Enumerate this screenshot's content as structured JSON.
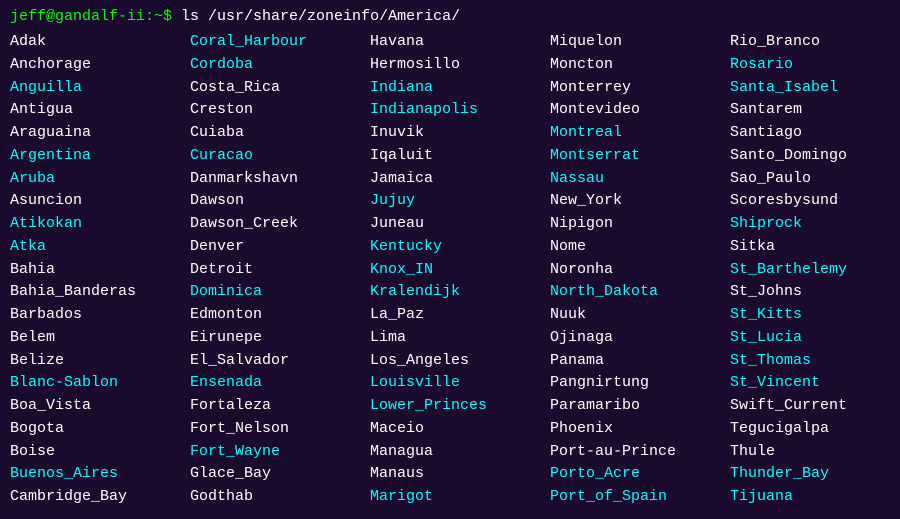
{
  "prompt": {
    "user": "jeff@gandalf-ii:~$",
    "command": " ls /usr/share/zoneinfo/America/"
  },
  "columns": [
    [
      {
        "text": "Adak",
        "color": "white"
      },
      {
        "text": "Anchorage",
        "color": "white"
      },
      {
        "text": "Anguilla",
        "color": "cyan"
      },
      {
        "text": "Antigua",
        "color": "white"
      },
      {
        "text": "Araguaina",
        "color": "white"
      },
      {
        "text": "Argentina",
        "color": "cyan"
      },
      {
        "text": "Aruba",
        "color": "cyan"
      },
      {
        "text": "Asuncion",
        "color": "white"
      },
      {
        "text": "Atikokan",
        "color": "cyan"
      },
      {
        "text": "Atka",
        "color": "cyan"
      },
      {
        "text": "Bahia",
        "color": "white"
      },
      {
        "text": "Bahia_Banderas",
        "color": "white"
      },
      {
        "text": "Barbados",
        "color": "white"
      },
      {
        "text": "Belem",
        "color": "white"
      },
      {
        "text": "Belize",
        "color": "white"
      },
      {
        "text": "Blanc-Sablon",
        "color": "cyan"
      },
      {
        "text": "Boa_Vista",
        "color": "white"
      },
      {
        "text": "Bogota",
        "color": "white"
      },
      {
        "text": "Boise",
        "color": "white"
      },
      {
        "text": "Buenos_Aires",
        "color": "cyan"
      },
      {
        "text": "Cambridge_Bay",
        "color": "white"
      }
    ],
    [
      {
        "text": "Coral_Harbour",
        "color": "cyan"
      },
      {
        "text": "Cordoba",
        "color": "cyan"
      },
      {
        "text": "Costa_Rica",
        "color": "white"
      },
      {
        "text": "Creston",
        "color": "white"
      },
      {
        "text": "Cuiaba",
        "color": "white"
      },
      {
        "text": "Curacao",
        "color": "cyan"
      },
      {
        "text": "Danmarkshavn",
        "color": "white"
      },
      {
        "text": "Dawson",
        "color": "white"
      },
      {
        "text": "Dawson_Creek",
        "color": "white"
      },
      {
        "text": "Denver",
        "color": "white"
      },
      {
        "text": "Detroit",
        "color": "white"
      },
      {
        "text": "Dominica",
        "color": "cyan"
      },
      {
        "text": "Edmonton",
        "color": "white"
      },
      {
        "text": "Eirunepe",
        "color": "white"
      },
      {
        "text": "El_Salvador",
        "color": "white"
      },
      {
        "text": "Ensenada",
        "color": "cyan"
      },
      {
        "text": "Fortaleza",
        "color": "white"
      },
      {
        "text": "Fort_Nelson",
        "color": "white"
      },
      {
        "text": "Fort_Wayne",
        "color": "cyan"
      },
      {
        "text": "Glace_Bay",
        "color": "white"
      },
      {
        "text": "Godthab",
        "color": "white"
      }
    ],
    [
      {
        "text": "Havana",
        "color": "white"
      },
      {
        "text": "Hermosillo",
        "color": "white"
      },
      {
        "text": "Indiana",
        "color": "cyan"
      },
      {
        "text": "Indianapolis",
        "color": "cyan"
      },
      {
        "text": "Inuvik",
        "color": "white"
      },
      {
        "text": "Iqaluit",
        "color": "white"
      },
      {
        "text": "Jamaica",
        "color": "white"
      },
      {
        "text": "Jujuy",
        "color": "cyan"
      },
      {
        "text": "Juneau",
        "color": "white"
      },
      {
        "text": "Kentucky",
        "color": "cyan"
      },
      {
        "text": "Knox_IN",
        "color": "cyan"
      },
      {
        "text": "Kralendijk",
        "color": "cyan"
      },
      {
        "text": "La_Paz",
        "color": "white"
      },
      {
        "text": "Lima",
        "color": "white"
      },
      {
        "text": "Los_Angeles",
        "color": "white"
      },
      {
        "text": "Louisville",
        "color": "cyan"
      },
      {
        "text": "Lower_Princes",
        "color": "cyan"
      },
      {
        "text": "Maceio",
        "color": "white"
      },
      {
        "text": "Managua",
        "color": "white"
      },
      {
        "text": "Manaus",
        "color": "white"
      },
      {
        "text": "Marigot",
        "color": "cyan"
      }
    ],
    [
      {
        "text": "Miquelon",
        "color": "white"
      },
      {
        "text": "Moncton",
        "color": "white"
      },
      {
        "text": "Monterrey",
        "color": "white"
      },
      {
        "text": "Montevideo",
        "color": "white"
      },
      {
        "text": "Montreal",
        "color": "cyan"
      },
      {
        "text": "Montserrat",
        "color": "cyan"
      },
      {
        "text": "Nassau",
        "color": "cyan"
      },
      {
        "text": "New_York",
        "color": "white"
      },
      {
        "text": "Nipigon",
        "color": "white"
      },
      {
        "text": "Nome",
        "color": "white"
      },
      {
        "text": "Noronha",
        "color": "white"
      },
      {
        "text": "North_Dakota",
        "color": "cyan"
      },
      {
        "text": "Nuuk",
        "color": "white"
      },
      {
        "text": "Ojinaga",
        "color": "white"
      },
      {
        "text": "Panama",
        "color": "white"
      },
      {
        "text": "Pangnirtung",
        "color": "white"
      },
      {
        "text": "Paramaribo",
        "color": "white"
      },
      {
        "text": "Phoenix",
        "color": "white"
      },
      {
        "text": "Port-au-Prince",
        "color": "white"
      },
      {
        "text": "Porto_Acre",
        "color": "cyan"
      },
      {
        "text": "Port_of_Spain",
        "color": "cyan"
      }
    ],
    [
      {
        "text": "Rio_Branco",
        "color": "white"
      },
      {
        "text": "Rosario",
        "color": "cyan"
      },
      {
        "text": "Santa_Isabel",
        "color": "cyan"
      },
      {
        "text": "Santarem",
        "color": "white"
      },
      {
        "text": "Santiago",
        "color": "white"
      },
      {
        "text": "Santo_Domingo",
        "color": "white"
      },
      {
        "text": "Sao_Paulo",
        "color": "white"
      },
      {
        "text": "Scoresbysund",
        "color": "white"
      },
      {
        "text": "Shiprock",
        "color": "cyan"
      },
      {
        "text": "Sitka",
        "color": "white"
      },
      {
        "text": "St_Barthelemy",
        "color": "cyan"
      },
      {
        "text": "St_Johns",
        "color": "white"
      },
      {
        "text": "St_Kitts",
        "color": "cyan"
      },
      {
        "text": "St_Lucia",
        "color": "cyan"
      },
      {
        "text": "St_Thomas",
        "color": "cyan"
      },
      {
        "text": "St_Vincent",
        "color": "cyan"
      },
      {
        "text": "Swift_Current",
        "color": "white"
      },
      {
        "text": "Tegucigalpa",
        "color": "white"
      },
      {
        "text": "Thule",
        "color": "white"
      },
      {
        "text": "Thunder_Bay",
        "color": "cyan"
      },
      {
        "text": "Tijuana",
        "color": "cyan"
      }
    ]
  ]
}
